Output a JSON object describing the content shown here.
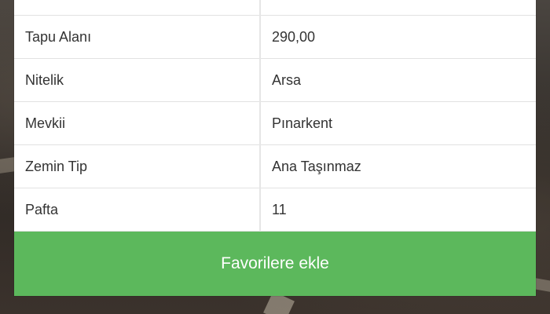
{
  "background": {
    "description_color": "#2f2a26"
  },
  "properties": {
    "rows": [
      {
        "label": "",
        "value": ""
      },
      {
        "label": "Tapu Alanı",
        "value": "290,00"
      },
      {
        "label": "Nitelik",
        "value": "Arsa"
      },
      {
        "label": "Mevkii",
        "value": "Pınarkent"
      },
      {
        "label": "Zemin Tip",
        "value": "Ana Taşınmaz"
      },
      {
        "label": "Pafta",
        "value": "11"
      }
    ]
  },
  "actions": {
    "favorite_label": "Favorilere ekle",
    "favorite_color": "#5cb85c"
  }
}
